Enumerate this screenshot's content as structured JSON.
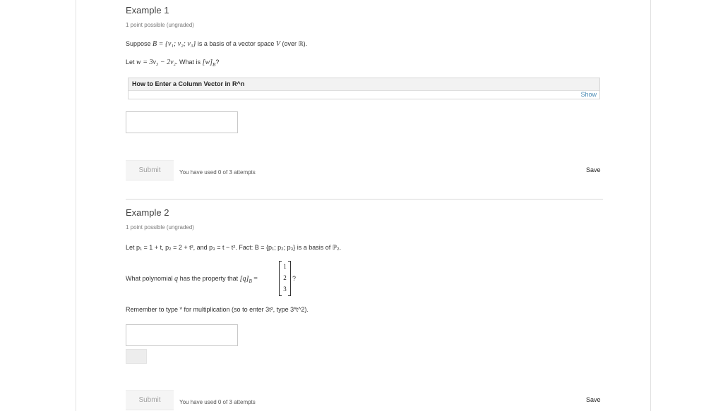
{
  "example1": {
    "title": "Example 1",
    "meta": "1 point possible (ungraded)",
    "line1_prefix": "Suppose",
    "line1_math": "B = {v₁; v₂; v₃}",
    "line1_suffix": "is a basis of a vector space",
    "line1_math2": "V",
    "line1_suffix2": "(over ℝ).",
    "line2_prefix": "Let",
    "line2_math": "w = 3v₃ − 2v₂.",
    "line2_mid": "What is",
    "line2_math2": "[w]",
    "line2_sub": "B",
    "line2_end": "?",
    "collapsible_title": "How to Enter a Column Vector in R^n",
    "collapsible_show": "Show",
    "input_value": "",
    "submit_label": "Submit",
    "attempts": "You have used 0 of 3 attempts",
    "save_label": "Save"
  },
  "example2": {
    "title": "Example 2",
    "meta": "1 point possible (ungraded)",
    "line1": "Let p₁ = 1 + t, p₂ = 2 + t², and p₃ = t − t². Fact: B = {p₁; p₂; p₃} is a basis of ℙ₂.",
    "line2_prefix": "What polynomial",
    "line2_math": "q",
    "line2_mid": "has the property that",
    "line2_math2": "[q]",
    "line2_sub": "B",
    "line2_eq": "=",
    "line2_end": "?",
    "vector": [
      "1",
      "2",
      "3"
    ],
    "hint": "Remember to type * for multiplication (so to enter 3t², type 3*t^2).",
    "input_value": "",
    "submit_label": "Submit",
    "attempts": "You have used 0 of 3 attempts",
    "save_label": "Save"
  }
}
